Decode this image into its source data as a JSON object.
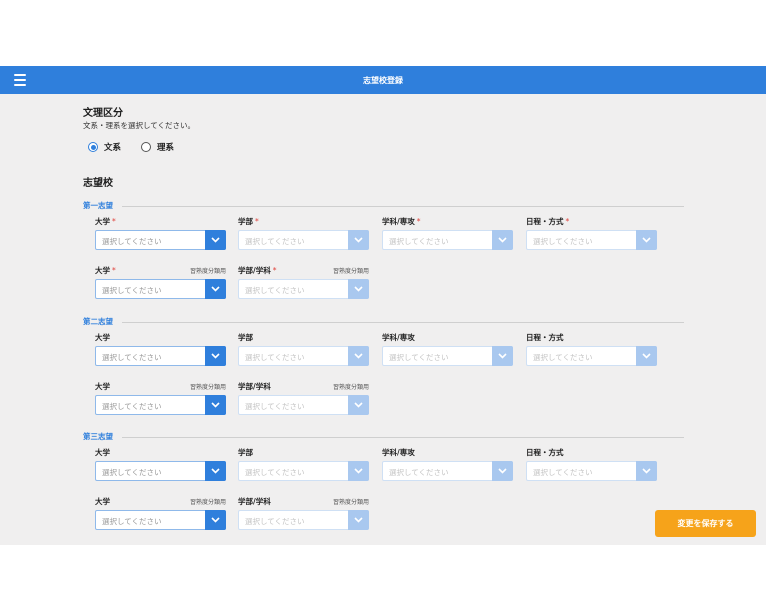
{
  "appbar": {
    "title": "志望校登録",
    "menu_icon": "menu-icon"
  },
  "category": {
    "title": "文理区分",
    "description": "文系・理系を選択してください。",
    "options": [
      {
        "label": "文系",
        "checked": true
      },
      {
        "label": "理系",
        "checked": false
      }
    ]
  },
  "schools": {
    "title": "志望校",
    "placeholder": "選択してください",
    "hint": "習熟度分類用",
    "required_mark": "*",
    "choices": [
      {
        "heading": "第一志望",
        "row1": [
          "大学",
          "学部",
          "学科/専攻",
          "日程・方式"
        ],
        "row1_required": [
          true,
          true,
          true,
          true
        ],
        "row2": [
          "大学",
          "学部/学科"
        ],
        "row2_required": [
          true,
          true
        ]
      },
      {
        "heading": "第二志望",
        "row1": [
          "大学",
          "学部",
          "学科/専攻",
          "日程・方式"
        ],
        "row1_required": [
          false,
          false,
          false,
          false
        ],
        "row2": [
          "大学",
          "学部/学科"
        ],
        "row2_required": [
          false,
          false
        ]
      },
      {
        "heading": "第三志望",
        "row1": [
          "大学",
          "学部",
          "学科/専攻",
          "日程・方式"
        ],
        "row1_required": [
          false,
          false,
          false,
          false
        ],
        "row2": [
          "大学",
          "学部/学科"
        ],
        "row2_required": [
          false,
          false
        ]
      }
    ]
  },
  "actions": {
    "save_label": "変更を保存する"
  },
  "colors": {
    "primary": "#2f7fdc",
    "accent": "#f6a31a",
    "required": "#e0403a",
    "background": "#f0efef"
  }
}
